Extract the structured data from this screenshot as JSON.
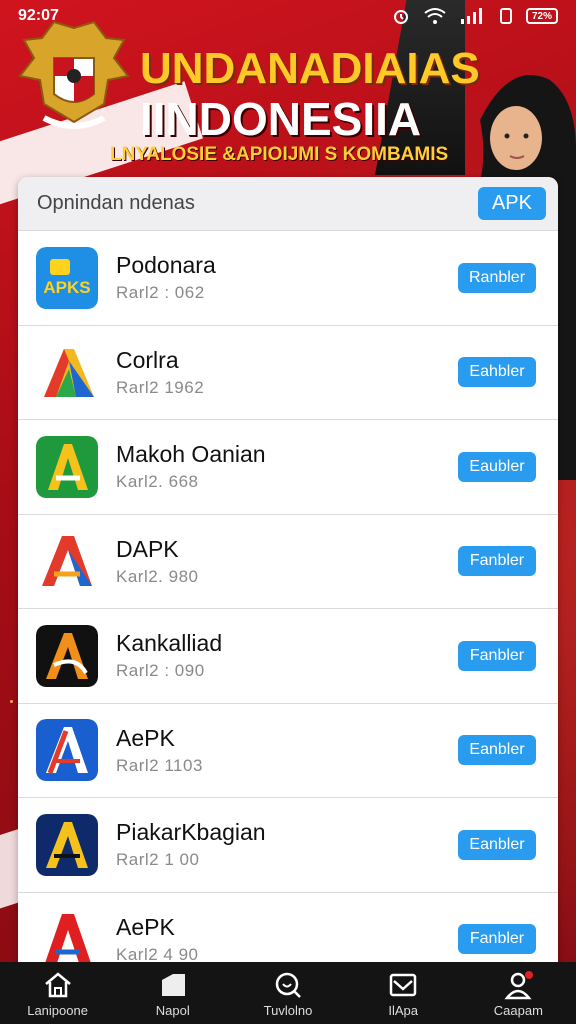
{
  "status_bar": {
    "time": "92:07",
    "battery": "72%",
    "icons": [
      "alarm-icon",
      "wifi-icon",
      "signal-icon",
      "vibrate-icon",
      "battery-icon"
    ]
  },
  "header": {
    "title_line1": "UNDANADIAIAS",
    "title_line2": "IINDONESIIA",
    "subtitle": "LNYALOSIE &APIOIJMI S KOMBAMIS",
    "colors": {
      "title_gold": "#ffc928",
      "background_red": "#c8141e"
    }
  },
  "card": {
    "title": "Opnindan ndenas",
    "apk_button_label": "APK",
    "accent_color": "#2a9cf0"
  },
  "apps": [
    {
      "name": "Podonara",
      "meta": "Rarl2 : 062",
      "button": "Ranbler",
      "icon": "apks-icon",
      "icon_text": "APKS"
    },
    {
      "name": "Corlra",
      "meta": "Rarl2 1962",
      "button": "Eahbler",
      "icon": "colorful-a-icon",
      "icon_text": "A"
    },
    {
      "name": "Makoh Oanian",
      "meta": "Karl2. 668",
      "button": "Eaubler",
      "icon": "green-a-icon",
      "icon_text": "A"
    },
    {
      "name": "DAPK",
      "meta": "Karl2. 980",
      "button": "Fanbler",
      "icon": "red-blue-a-icon",
      "icon_text": "A"
    },
    {
      "name": "Kankalliad",
      "meta": "Rarl2 : 090",
      "button": "Fanbler",
      "icon": "dark-a-icon",
      "icon_text": "A"
    },
    {
      "name": "AePK",
      "meta": "Rarl2 1103",
      "button": "Eanbler",
      "icon": "blue-a-icon",
      "icon_text": "A"
    },
    {
      "name": "PiakarKbagian",
      "meta": "Rarl2 1 00",
      "button": "Eanbler",
      "icon": "navy-gold-a-icon",
      "icon_text": "A"
    },
    {
      "name": "AePK",
      "meta": "Karl2 4 90",
      "button": "Fanbler",
      "icon": "red-a-icon",
      "icon_text": "A"
    }
  ],
  "nav": [
    {
      "label": "Lanipoone",
      "icon": "home-icon"
    },
    {
      "label": "Napol",
      "icon": "tag-icon"
    },
    {
      "label": "Tuvlolno",
      "icon": "search-icon"
    },
    {
      "label": "IlApa",
      "icon": "mail-icon"
    },
    {
      "label": "Caapam",
      "icon": "profile-icon"
    }
  ]
}
